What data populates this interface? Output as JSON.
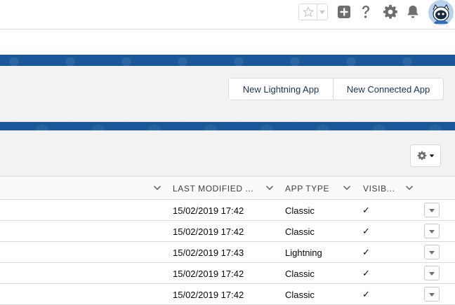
{
  "global_header": {
    "icons": [
      "star-icon",
      "chevron-down-icon",
      "add-icon",
      "help-icon",
      "setup-gear-icon",
      "notifications-bell-icon",
      "avatar-icon"
    ]
  },
  "page_header": {
    "buttons": {
      "new_lightning_app": "New Lightning App",
      "new_connected_app": "New Connected App"
    }
  },
  "list_view": {
    "columns": {
      "last_modified": "LAST MODIFIED ...",
      "app_type": "APP TYPE",
      "visible": "VISIB..."
    },
    "rows": [
      {
        "last_modified": "15/02/2019 17:42",
        "app_type": "Classic",
        "visible": "✓"
      },
      {
        "last_modified": "15/02/2019 17:42",
        "app_type": "Classic",
        "visible": "✓"
      },
      {
        "last_modified": "15/02/2019 17:43",
        "app_type": "Lightning",
        "visible": "✓"
      },
      {
        "last_modified": "15/02/2019 17:42",
        "app_type": "Classic",
        "visible": "✓"
      },
      {
        "last_modified": "15/02/2019 17:42",
        "app_type": "Classic",
        "visible": "✓"
      }
    ]
  },
  "colors": {
    "brand_band": "#1a5798",
    "icon_gray": "#706e6b",
    "border": "#dddbda",
    "button_text": "#16325c"
  }
}
